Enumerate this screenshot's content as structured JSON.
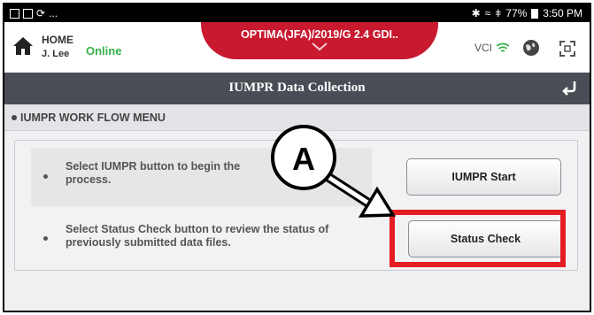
{
  "status_bar": {
    "left_ellipsis": "...",
    "right_text": "77%",
    "time": "3:50 PM"
  },
  "header": {
    "home_label": "HOME",
    "user": "J. Lee",
    "connection_status": "Online",
    "vehicle": "OPTIMA(JFA)/2019/G 2.4 GDI..",
    "vci_label": "VCI",
    "icons": [
      "home-icon",
      "chevron-down-icon",
      "wifi-icon",
      "globe-icon",
      "expand-icon"
    ]
  },
  "title_bar": {
    "title": "IUMPR Data Collection",
    "back_icon": "back-arrow-icon"
  },
  "section": {
    "title": "IUMPR WORK FLOW MENU"
  },
  "workflow": {
    "rows": [
      {
        "description": "Select IUMPR button to begin the\nprocess.",
        "button_label": "IUMPR Start"
      },
      {
        "description": "Select Status Check button to review the status of\npreviously submitted data files.",
        "button_label": "Status Check"
      }
    ]
  },
  "annotation": {
    "callout_letter": "A",
    "highlight_color": "#e41d23"
  },
  "colors": {
    "vehicle_tab": "#c8192e",
    "online": "#36b24a",
    "title_bar": "#4a4d55"
  }
}
